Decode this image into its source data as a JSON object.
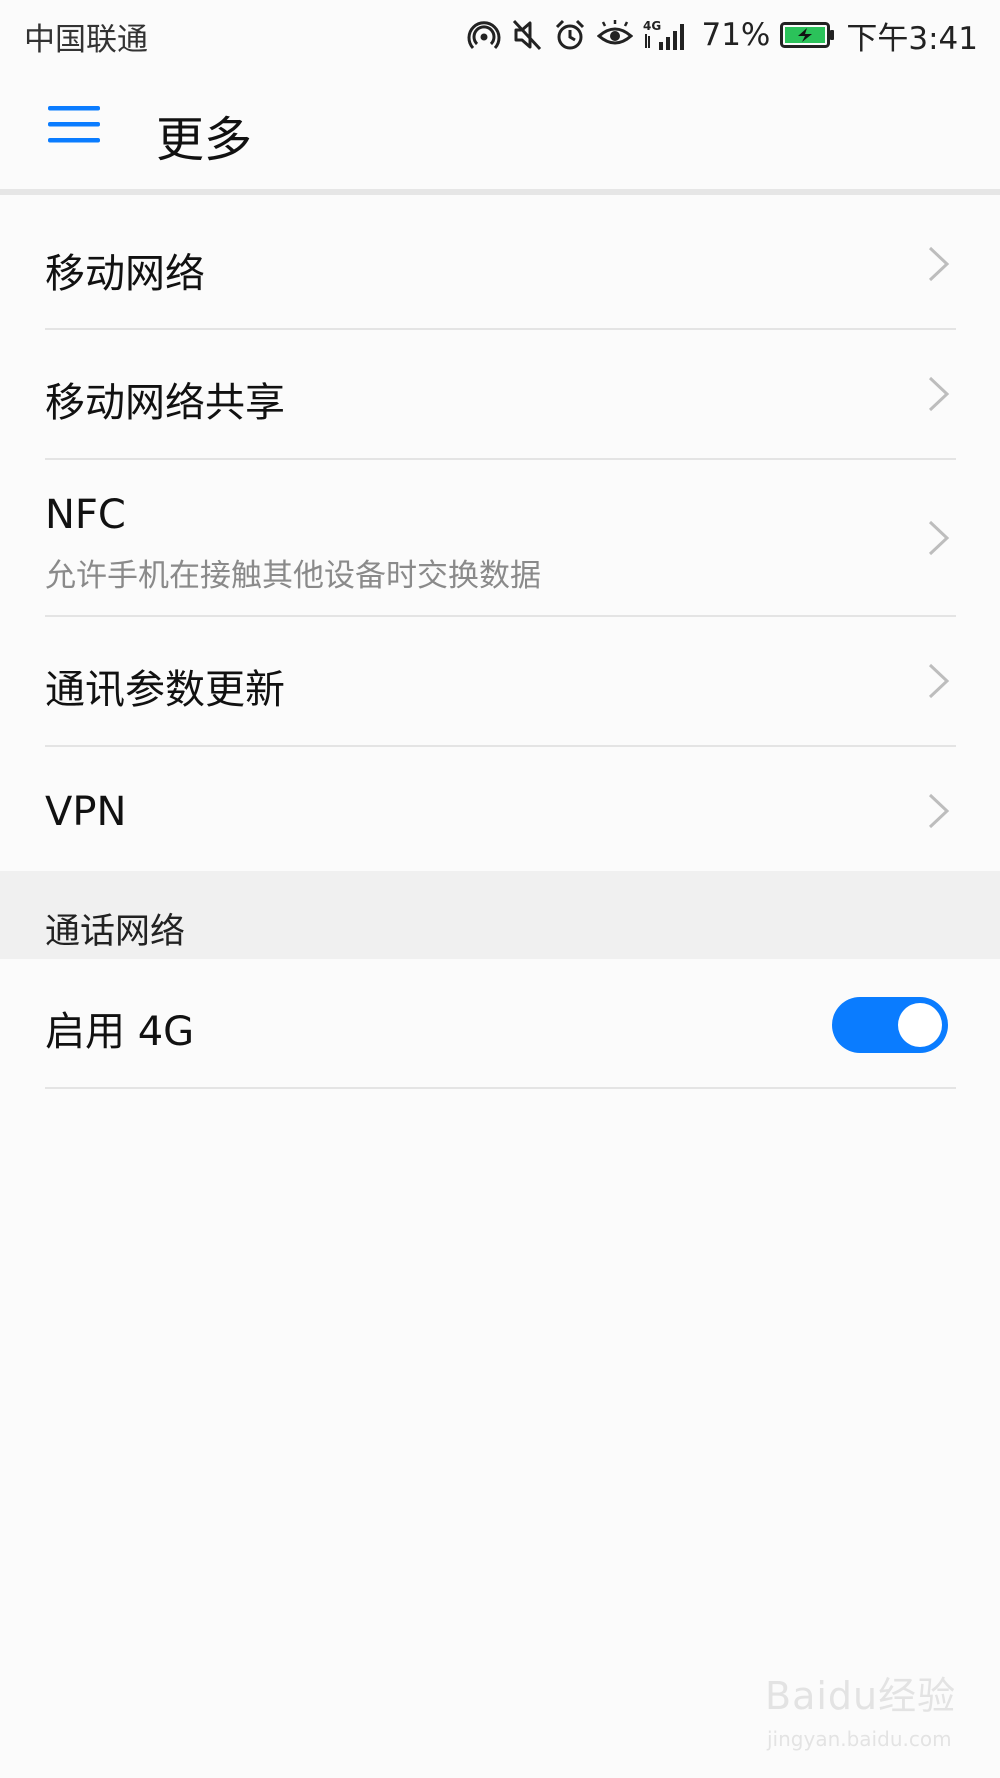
{
  "status_bar": {
    "carrier": "中国联通",
    "network_type": "4G",
    "battery_percent": "71%",
    "battery_level": 0.71,
    "time": "下午3:41",
    "icons": [
      "hotspot-icon",
      "mute-icon",
      "alarm-icon",
      "eye-comfort-icon",
      "signal-icon",
      "battery-charging-icon"
    ]
  },
  "app_bar": {
    "title": "更多",
    "menu_icon": "menu-icon",
    "accent_color": "#0a7cff"
  },
  "items": [
    {
      "label": "移动网络"
    },
    {
      "label": "移动网络共享"
    },
    {
      "label": "NFC",
      "subtitle": "允许手机在接触其他设备时交换数据"
    },
    {
      "label": "通讯参数更新"
    },
    {
      "label": "VPN"
    }
  ],
  "section": {
    "title": "通话网络"
  },
  "toggle_item": {
    "label": "启用 4G",
    "enabled": true,
    "on_color": "#0a7cff"
  },
  "watermark": {
    "main": "Baidu经验",
    "sub": "jingyan.baidu.com"
  }
}
